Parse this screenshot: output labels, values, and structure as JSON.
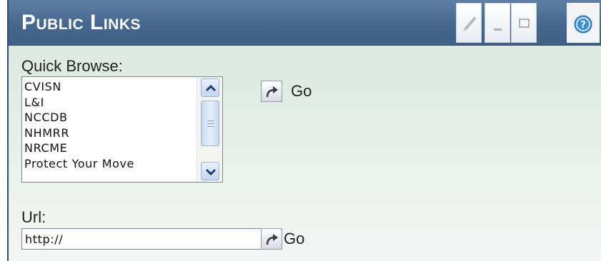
{
  "portlet": {
    "title": "Public Links",
    "header_buttons": [
      "edit-icon",
      "minimize-icon",
      "maximize-icon",
      "help-icon"
    ]
  },
  "quick_browse": {
    "label": "Quick Browse:",
    "options": [
      "CVISN",
      "L&I",
      "NCCDB",
      "NHMRR",
      "NRCME",
      "Protect Your Move"
    ],
    "go_label": "Go"
  },
  "url": {
    "label": "Url:",
    "value": "http://",
    "go_label": "Go"
  },
  "colors": {
    "header": "#47688f",
    "body_background": "#d6e5dc",
    "scroll_accent": "#c6d6ee"
  }
}
